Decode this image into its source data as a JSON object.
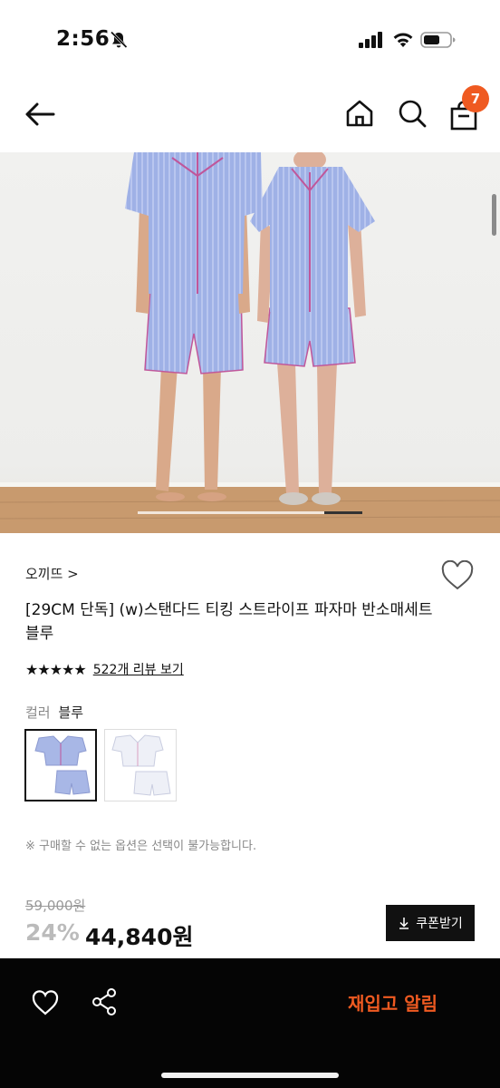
{
  "status_bar": {
    "time": "2:56"
  },
  "nav": {
    "cart_count": "7"
  },
  "product": {
    "brand": "오끼뜨 >",
    "title": "[29CM 단독] (w)스탠다드 티킹 스트라이프 파자마 반소매세트 블루",
    "stars": "★★★★★",
    "review_link": "522개 리뷰 보기",
    "color_label": "컬러",
    "color_value": "블루",
    "notice": "※ 구매할 수 없는 옵션은 선택이 불가능합니다.",
    "original_price": "59,000원",
    "discount": "24%",
    "price": "44,840원",
    "coupon_label": "쿠폰받기"
  },
  "bottom_bar": {
    "restock_label": "재입고 알림"
  },
  "colors": {
    "accent": "#ef5a21",
    "swatch_blue": "#a8b7e6",
    "swatch_white": "#eef0f7"
  }
}
